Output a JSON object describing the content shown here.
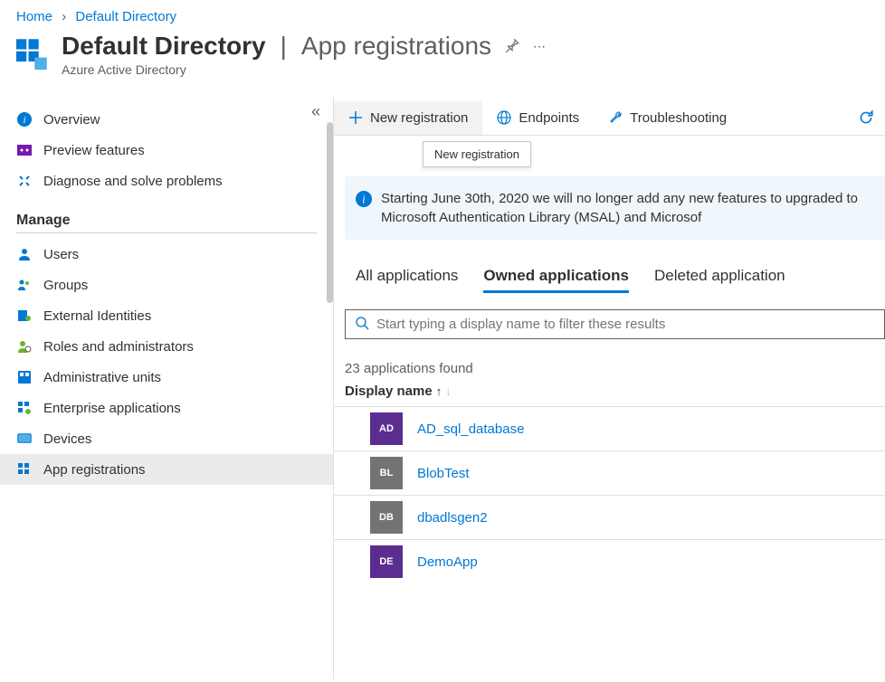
{
  "breadcrumb": {
    "home": "Home",
    "current": "Default Directory"
  },
  "header": {
    "title_bold": "Default Directory",
    "title_thin": "App registrations",
    "subtitle": "Azure Active Directory"
  },
  "sidebar": {
    "items_top": [
      {
        "label": "Overview"
      },
      {
        "label": "Preview features"
      },
      {
        "label": "Diagnose and solve problems"
      }
    ],
    "manage_header": "Manage",
    "items_manage": [
      {
        "label": "Users"
      },
      {
        "label": "Groups"
      },
      {
        "label": "External Identities"
      },
      {
        "label": "Roles and administrators"
      },
      {
        "label": "Administrative units"
      },
      {
        "label": "Enterprise applications"
      },
      {
        "label": "Devices"
      },
      {
        "label": "App registrations"
      }
    ]
  },
  "toolbar": {
    "new_registration": "New registration",
    "endpoints": "Endpoints",
    "troubleshooting": "Troubleshooting",
    "tooltip": "New registration"
  },
  "banner": {
    "text": "Starting June 30th, 2020 we will no longer add any new features to upgraded to Microsoft Authentication Library (MSAL) and Microsof"
  },
  "tabs": {
    "all": "All applications",
    "owned": "Owned applications",
    "deleted": "Deleted application"
  },
  "search": {
    "placeholder": "Start typing a display name to filter these results"
  },
  "list": {
    "count": "23 applications found",
    "col_header": "Display name",
    "rows": [
      {
        "badge": "AD",
        "badge_color": "purple",
        "name": "AD_sql_database"
      },
      {
        "badge": "BL",
        "badge_color": "gray",
        "name": "BlobTest"
      },
      {
        "badge": "DB",
        "badge_color": "gray",
        "name": "dbadlsgen2"
      },
      {
        "badge": "DE",
        "badge_color": "purple",
        "name": "DemoApp"
      }
    ]
  }
}
